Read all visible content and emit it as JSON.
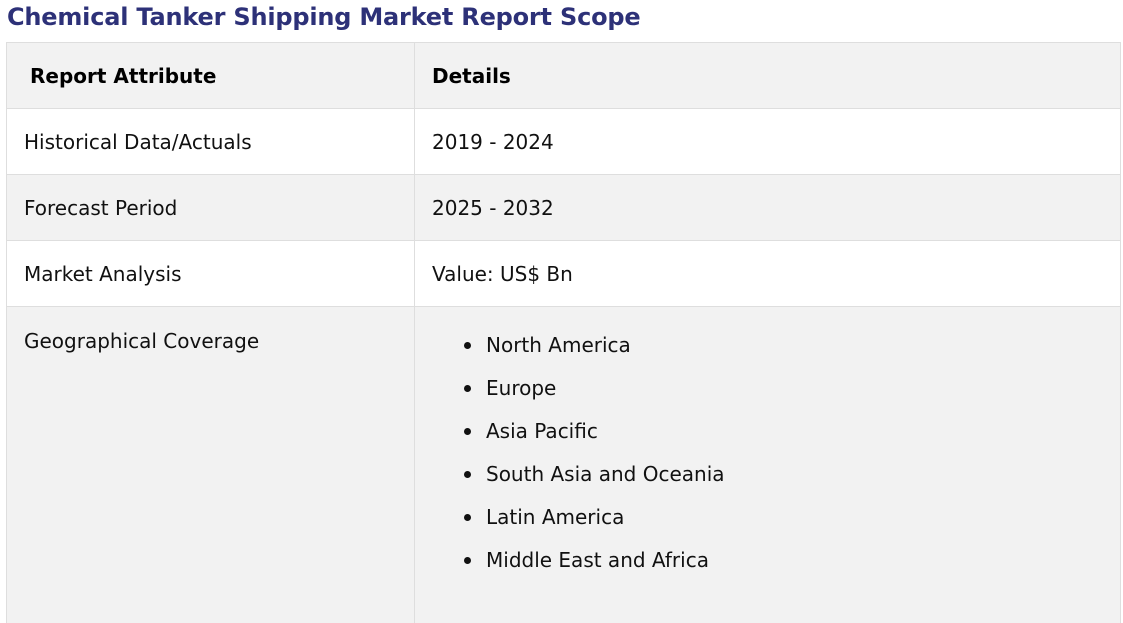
{
  "title": "Chemical Tanker Shipping Market Report Scope",
  "table": {
    "headers": {
      "attribute": "Report Attribute",
      "details": "Details"
    },
    "rows": [
      {
        "attribute": "Historical Data/Actuals",
        "details": "2019 - 2024"
      },
      {
        "attribute": "Forecast Period",
        "details": "2025 - 2032"
      },
      {
        "attribute": "Market Analysis",
        "details": "Value: US$ Bn"
      }
    ],
    "geography": {
      "attribute": "Geographical Coverage",
      "regions": [
        "North America",
        "Europe",
        "Asia Pacific",
        "South Asia and Oceania",
        "Latin America",
        "Middle East and Africa"
      ]
    }
  },
  "colors": {
    "title": "#2d3178",
    "shaded_row": "#f2f2f2",
    "border": "#dedede"
  }
}
